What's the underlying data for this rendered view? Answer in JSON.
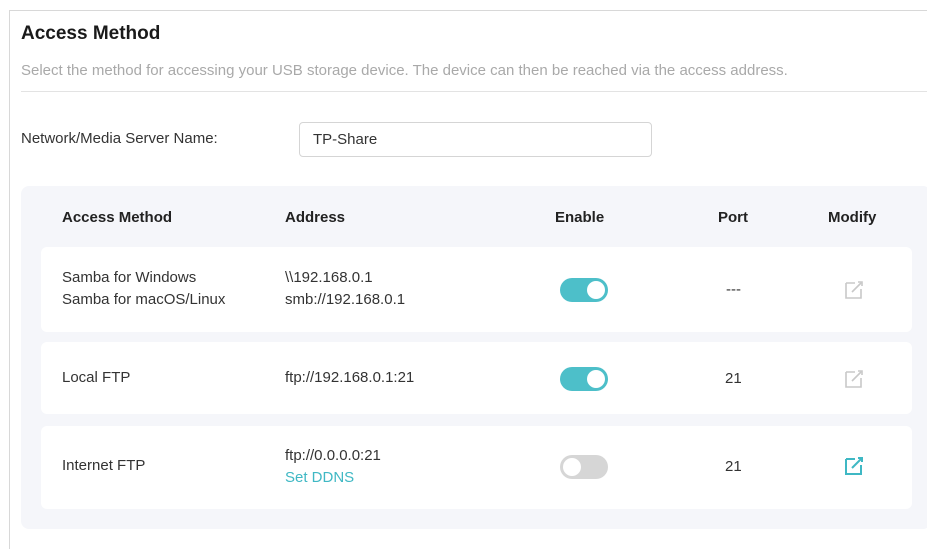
{
  "section": {
    "title": "Access Method",
    "subtitle": "Select the method for accessing your USB storage device. The device can then be reached via the access address."
  },
  "server_name": {
    "label": "Network/Media Server Name:",
    "value": "TP-Share"
  },
  "table": {
    "headers": {
      "method": "Access Method",
      "address": "Address",
      "enable": "Enable",
      "port": "Port",
      "modify": "Modify"
    },
    "rows": [
      {
        "method_line1": "Samba for Windows",
        "method_line2": "Samba for macOS/Linux",
        "address_line1": "\\\\192.168.0.1",
        "address_line2": "smb://192.168.0.1",
        "enabled": true,
        "port": "---",
        "modify_enabled": false
      },
      {
        "method": "Local FTP",
        "address": "ftp://192.168.0.1:21",
        "enabled": true,
        "port": "21",
        "modify_enabled": false
      },
      {
        "method": "Internet FTP",
        "address_line1": "ftp://0.0.0.0:21",
        "address_link": "Set DDNS",
        "enabled": false,
        "port": "21",
        "modify_enabled": true
      }
    ]
  },
  "colors": {
    "accent": "#4dbfc9",
    "toggle_off": "#d6d6d6",
    "edit_disabled": "#c8c8c8",
    "link": "#3fb8c4"
  },
  "icons": {
    "toggle": "toggle-switch",
    "edit": "edit-icon"
  }
}
